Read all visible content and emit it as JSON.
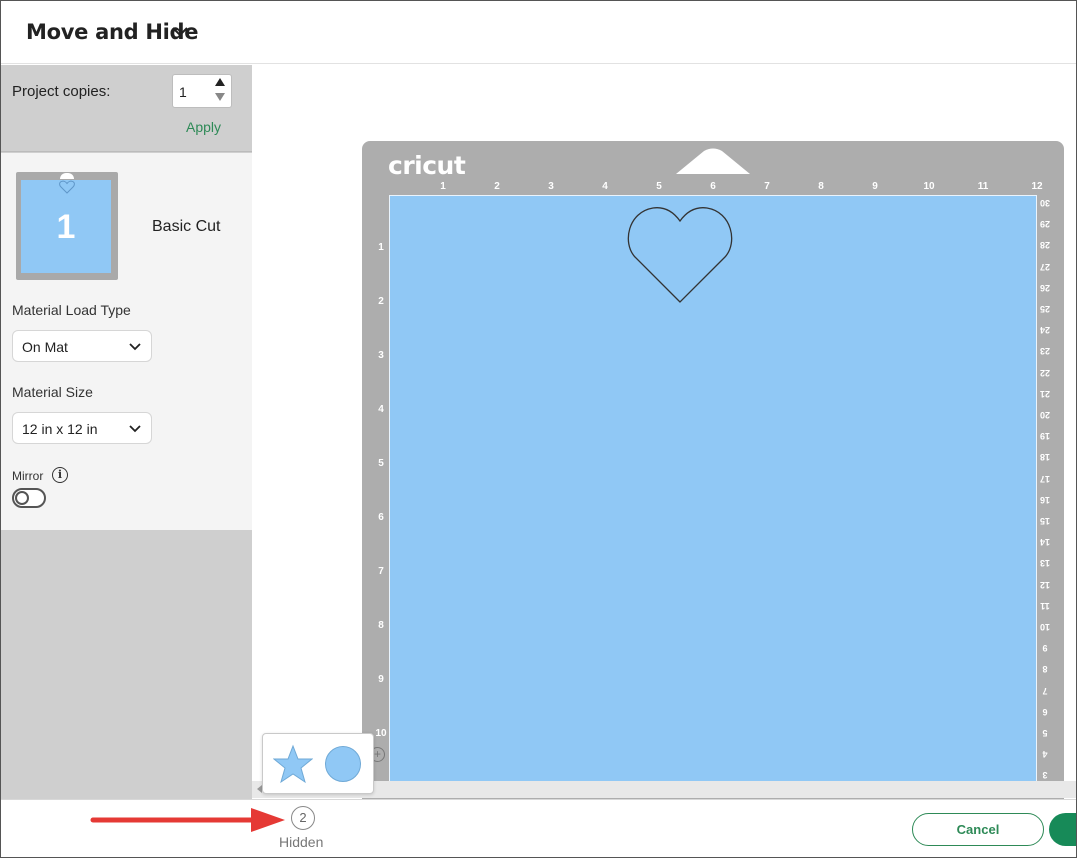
{
  "header": {
    "title": "Move and Hide"
  },
  "left_panel": {
    "project_copies_label": "Project copies:",
    "project_copies_value": "1",
    "apply_label": "Apply",
    "mat_number": "1",
    "mat_name": "Basic Cut",
    "material_load_type_label": "Material Load Type",
    "material_load_type_value": "On Mat",
    "material_size_label": "Material Size",
    "material_size_value": "12 in x 12 in",
    "mirror_label": "Mirror",
    "mirror_on": false
  },
  "mat": {
    "logo": "cricut",
    "top_ruler": [
      "1",
      "2",
      "3",
      "4",
      "5",
      "6",
      "7",
      "8",
      "9",
      "10",
      "11",
      "12"
    ],
    "left_ruler": [
      "1",
      "2",
      "3",
      "4",
      "5",
      "6",
      "7",
      "8",
      "9",
      "10"
    ],
    "right_ruler": [
      "30",
      "29",
      "28",
      "27",
      "26",
      "25",
      "24",
      "23",
      "22",
      "21",
      "20",
      "19",
      "18",
      "17",
      "16",
      "15",
      "14",
      "13",
      "12",
      "11",
      "10",
      "9",
      "8",
      "7",
      "6",
      "5",
      "4",
      "3"
    ],
    "mat_color": "#90c8f5"
  },
  "hidden_popup": {
    "items": [
      "star-shape",
      "circle-shape"
    ]
  },
  "bottom_bar": {
    "hidden_count": "2",
    "hidden_label": "Hidden",
    "cancel_label": "Cancel"
  },
  "colors": {
    "accent_green": "#2e8a57",
    "annotation_arrow": "#e53935",
    "mat_blue": "#90c8f5",
    "mat_gray": "#adadad"
  }
}
